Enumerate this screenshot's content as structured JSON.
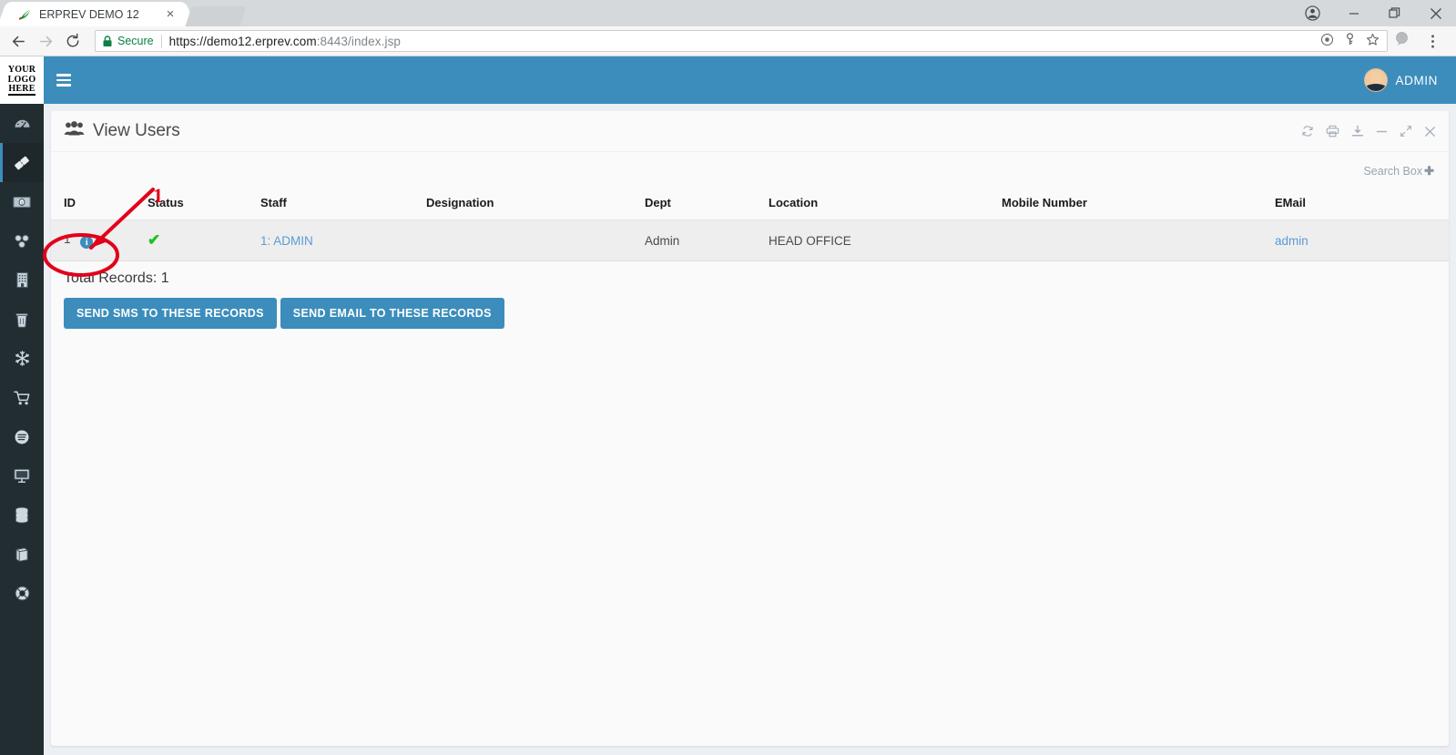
{
  "browser": {
    "tab": {
      "title": "ERPREV DEMO 12",
      "favicon": "leaf-icon",
      "close": "×"
    },
    "window_controls": {
      "profile": "profile-icon",
      "minimize": "−",
      "maximize": "▢",
      "close": "✕"
    },
    "toolbar": {
      "back": "←",
      "forward": "→",
      "reload": "⟳",
      "secure_label": "Secure",
      "url_scheme": "https://",
      "url_host": "demo12.erprev.com",
      "url_port": ":8443",
      "url_path": "/index.jsp",
      "url_full": "https://demo12.erprev.com:8443/index.jsp",
      "icons": [
        "target-icon",
        "key-icon",
        "star-icon",
        "extension-icon",
        "menu-dots-icon"
      ]
    }
  },
  "app": {
    "logo": {
      "line1": "YOUR",
      "line2": "LOGO",
      "line3": "HERE"
    },
    "topbar": {
      "menu_toggle": "hamburger-icon",
      "user_name": "ADMIN"
    },
    "sidebar": {
      "items": [
        {
          "icon": "dashboard-gauge-icon",
          "active": false
        },
        {
          "icon": "tag-ticket-icon",
          "active": true
        },
        {
          "icon": "money-bill-icon",
          "active": false
        },
        {
          "icon": "sitemap-share-icon",
          "active": false
        },
        {
          "icon": "building-icon",
          "active": false
        },
        {
          "icon": "trash-icon",
          "active": false
        },
        {
          "icon": "snowflake-icon",
          "active": false
        },
        {
          "icon": "shopping-cart-icon",
          "active": false
        },
        {
          "icon": "disc-icon",
          "active": false
        },
        {
          "icon": "desktop-monitor-icon",
          "active": false
        },
        {
          "icon": "database-icon",
          "active": false
        },
        {
          "icon": "book-icon",
          "active": false
        },
        {
          "icon": "lifebuoy-icon",
          "active": false
        }
      ]
    },
    "panel": {
      "title": "View Users",
      "title_icon": "users-group-icon",
      "tools": [
        {
          "name": "refresh",
          "icon": "refresh-icon"
        },
        {
          "name": "print",
          "icon": "print-icon"
        },
        {
          "name": "download",
          "icon": "download-icon"
        },
        {
          "name": "minimize",
          "icon": "minus-icon"
        },
        {
          "name": "expand",
          "icon": "expand-arrows-icon"
        },
        {
          "name": "close",
          "icon": "close-x-icon"
        }
      ],
      "search": {
        "label": "Search Box",
        "plus": "✚"
      },
      "table": {
        "columns": [
          "ID",
          "Status",
          "Staff",
          "Designation",
          "Dept",
          "Location",
          "Mobile Number",
          "EMail"
        ],
        "rows": [
          {
            "id": "1",
            "id_info_icon": "info-circle-icon",
            "status": "✔",
            "staff": "1: ADMIN",
            "designation": "",
            "dept": "Admin",
            "location": "HEAD OFFICE",
            "mobile": "",
            "email": "admin"
          }
        ]
      },
      "total_records": "Total Records: 1",
      "buttons": [
        {
          "label": "SEND SMS TO THESE RECORDS"
        },
        {
          "label": "SEND EMAIL TO THESE RECORDS"
        }
      ]
    }
  },
  "annotation": {
    "marker_number": "1",
    "color": "#e2001a",
    "shape": "ellipse-with-arrow-pointing-to-id-cell"
  },
  "colors": {
    "brand_blue": "#3c8dbc",
    "sidebar_dark": "#222d32",
    "app_bg": "#eceff3",
    "link_blue": "#5b9bd5",
    "status_green": "#1ec21e",
    "annotation_red": "#e2001a"
  }
}
